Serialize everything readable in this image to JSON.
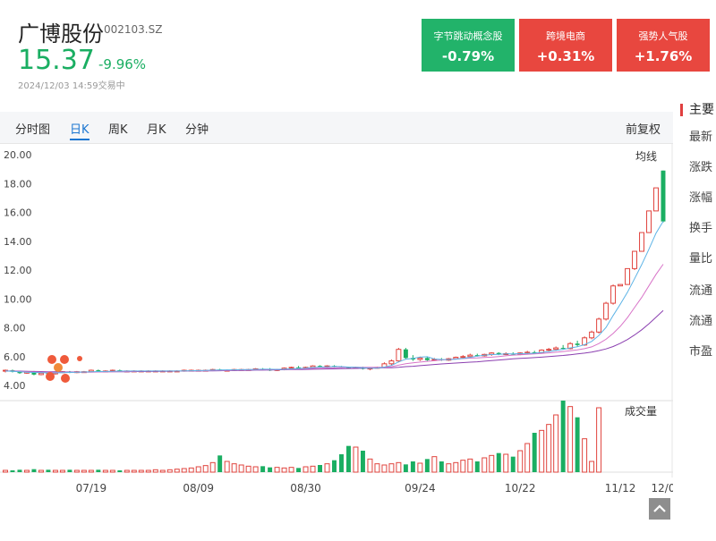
{
  "stock": {
    "name": "广博股份",
    "code": "002103.SZ",
    "price": "15.37",
    "change": "-9.96%",
    "time": "2024/12/03 14:59交易中"
  },
  "concepts": [
    {
      "name": "字节跳动概念股",
      "value": "-0.79%",
      "color": "#22b36a"
    },
    {
      "name": "跨境电商",
      "value": "+0.31%",
      "color": "#e8473f"
    },
    {
      "name": "强势人气股",
      "value": "+1.76%",
      "color": "#e8473f"
    }
  ],
  "tabs": [
    {
      "label": "分时图"
    },
    {
      "label": "日K"
    },
    {
      "label": "周K"
    },
    {
      "label": "月K"
    },
    {
      "label": "分钟"
    }
  ],
  "active_tab": "日K",
  "adjust_label": "前复权",
  "sidebar": {
    "title": "主要",
    "items": [
      "最新",
      "涨跌",
      "涨幅",
      "换手",
      "量比",
      "流通",
      "流通",
      "市盈"
    ]
  },
  "colors": {
    "up": "#e0433d",
    "down": "#1aae62",
    "ma5": "#5cb3e6",
    "ma10": "#d874c8",
    "ma20": "#8b3fb0"
  },
  "icons": {
    "logo": "weibo-logo-icon",
    "scroll": "chevron-up-icon"
  },
  "chart_data": {
    "type": "candlestick",
    "ma_label": "均线",
    "volume_label": "成交量",
    "y_ticks": [
      "20.00",
      "18.00",
      "16.00",
      "14.00",
      "12.00",
      "10.00",
      "8.00",
      "6.00",
      "4.00"
    ],
    "ylim": [
      4,
      20
    ],
    "x_ticks": [
      "07/19",
      "08/09",
      "08/30",
      "09/24",
      "10/22",
      "11/12",
      "12/0"
    ],
    "candles": [
      [
        5.0,
        5.1,
        4.9,
        5.05
      ],
      [
        5.05,
        5.1,
        4.9,
        4.95
      ],
      [
        4.95,
        5.0,
        4.8,
        4.85
      ],
      [
        4.85,
        5.0,
        4.8,
        4.95
      ],
      [
        4.95,
        5.0,
        4.7,
        4.75
      ],
      [
        4.75,
        4.9,
        4.7,
        4.85
      ],
      [
        4.85,
        4.9,
        4.75,
        4.8
      ],
      [
        4.8,
        4.95,
        4.75,
        4.9
      ],
      [
        4.9,
        5.0,
        4.85,
        4.95
      ],
      [
        4.95,
        5.0,
        4.85,
        4.9
      ],
      [
        4.9,
        5.0,
        4.85,
        4.95
      ],
      [
        4.95,
        5.0,
        4.9,
        4.95
      ],
      [
        4.95,
        5.1,
        4.9,
        5.05
      ],
      [
        5.05,
        5.1,
        4.95,
        5.0
      ],
      [
        5.0,
        5.05,
        4.95,
        5.0
      ],
      [
        5.0,
        5.1,
        4.95,
        5.05
      ],
      [
        5.05,
        5.1,
        5.0,
        5.0
      ],
      [
        5.0,
        5.05,
        4.95,
        5.0
      ],
      [
        5.0,
        5.05,
        4.95,
        5.0
      ],
      [
        5.0,
        5.05,
        4.95,
        5.0
      ],
      [
        5.0,
        5.05,
        4.95,
        5.0
      ],
      [
        5.0,
        5.05,
        4.95,
        5.0
      ],
      [
        5.0,
        5.05,
        4.95,
        5.0
      ],
      [
        5.0,
        5.05,
        4.95,
        5.0
      ],
      [
        5.0,
        5.05,
        4.95,
        5.0
      ],
      [
        5.0,
        5.1,
        4.95,
        5.05
      ],
      [
        5.05,
        5.1,
        5.0,
        5.05
      ],
      [
        5.05,
        5.1,
        5.0,
        5.05
      ],
      [
        5.05,
        5.1,
        5.0,
        5.05
      ],
      [
        5.05,
        5.15,
        5.0,
        5.1
      ],
      [
        5.1,
        5.15,
        5.0,
        5.05
      ],
      [
        5.05,
        5.1,
        5.0,
        5.05
      ],
      [
        5.05,
        5.15,
        5.0,
        5.1
      ],
      [
        5.1,
        5.15,
        5.05,
        5.1
      ],
      [
        5.1,
        5.15,
        5.05,
        5.1
      ],
      [
        5.1,
        5.2,
        5.05,
        5.15
      ],
      [
        5.15,
        5.2,
        5.05,
        5.1
      ],
      [
        5.1,
        5.2,
        5.0,
        5.05
      ],
      [
        5.05,
        5.15,
        5.0,
        5.1
      ],
      [
        5.1,
        5.25,
        5.05,
        5.2
      ],
      [
        5.2,
        5.3,
        5.1,
        5.25
      ],
      [
        5.25,
        5.35,
        5.15,
        5.2
      ],
      [
        5.2,
        5.3,
        5.15,
        5.25
      ],
      [
        5.25,
        5.4,
        5.2,
        5.35
      ],
      [
        5.35,
        5.4,
        5.25,
        5.3
      ],
      [
        5.3,
        5.4,
        5.25,
        5.35
      ],
      [
        5.35,
        5.4,
        5.25,
        5.3
      ],
      [
        5.3,
        5.35,
        5.2,
        5.25
      ],
      [
        5.25,
        5.3,
        5.15,
        5.2
      ],
      [
        5.2,
        5.3,
        5.15,
        5.25
      ],
      [
        5.25,
        5.3,
        5.1,
        5.15
      ],
      [
        5.15,
        5.25,
        5.05,
        5.2
      ],
      [
        5.2,
        5.3,
        5.15,
        5.25
      ],
      [
        5.25,
        5.6,
        5.2,
        5.5
      ],
      [
        5.5,
        5.8,
        5.4,
        5.7
      ],
      [
        5.7,
        6.6,
        5.6,
        6.5
      ],
      [
        6.5,
        6.6,
        5.8,
        5.9
      ],
      [
        5.9,
        6.1,
        5.7,
        5.8
      ],
      [
        5.8,
        6.0,
        5.7,
        5.9
      ],
      [
        5.9,
        6.0,
        5.7,
        5.75
      ],
      [
        5.75,
        5.9,
        5.7,
        5.8
      ],
      [
        5.8,
        5.9,
        5.7,
        5.75
      ],
      [
        5.75,
        5.9,
        5.7,
        5.85
      ],
      [
        5.85,
        6.0,
        5.8,
        5.95
      ],
      [
        5.95,
        6.1,
        5.85,
        6.0
      ],
      [
        6.0,
        6.2,
        5.9,
        6.1
      ],
      [
        6.1,
        6.2,
        6.0,
        6.05
      ],
      [
        6.05,
        6.2,
        6.0,
        6.15
      ],
      [
        6.15,
        6.3,
        6.05,
        6.25
      ],
      [
        6.25,
        6.3,
        6.1,
        6.15
      ],
      [
        6.15,
        6.3,
        6.1,
        6.2
      ],
      [
        6.2,
        6.3,
        6.1,
        6.15
      ],
      [
        6.15,
        6.3,
        6.1,
        6.25
      ],
      [
        6.25,
        6.4,
        6.15,
        6.3
      ],
      [
        6.3,
        6.4,
        6.2,
        6.25
      ],
      [
        6.25,
        6.5,
        6.2,
        6.45
      ],
      [
        6.45,
        6.6,
        6.35,
        6.5
      ],
      [
        6.5,
        6.7,
        6.4,
        6.6
      ],
      [
        6.6,
        6.8,
        6.5,
        6.55
      ],
      [
        6.55,
        7.0,
        6.5,
        6.9
      ],
      [
        6.9,
        7.1,
        6.7,
        6.8
      ],
      [
        6.8,
        7.4,
        6.75,
        7.3
      ],
      [
        7.3,
        7.8,
        7.2,
        7.7
      ],
      [
        7.7,
        8.7,
        7.6,
        8.6
      ],
      [
        8.6,
        9.8,
        8.5,
        9.7
      ],
      [
        9.7,
        11.0,
        9.6,
        10.9
      ],
      [
        10.9,
        11.0,
        10.9,
        11.0
      ],
      [
        11.0,
        12.1,
        11.0,
        12.1
      ],
      [
        12.1,
        13.3,
        12.0,
        13.3
      ],
      [
        13.3,
        14.6,
        13.3,
        14.6
      ],
      [
        14.6,
        16.1,
        14.6,
        16.1
      ],
      [
        16.1,
        17.7,
        16.1,
        17.7
      ],
      [
        18.9,
        18.9,
        15.3,
        15.37
      ]
    ],
    "volumes": [
      3,
      3,
      4,
      3,
      5,
      3,
      4,
      3,
      3,
      4,
      3,
      3,
      3,
      4,
      3,
      3,
      3,
      3,
      3,
      3,
      3,
      4,
      3,
      4,
      5,
      6,
      7,
      9,
      11,
      16,
      28,
      18,
      14,
      12,
      10,
      9,
      10,
      8,
      8,
      7,
      8,
      7,
      9,
      10,
      12,
      14,
      20,
      30,
      44,
      42,
      36,
      22,
      14,
      12,
      14,
      16,
      13,
      18,
      15,
      22,
      26,
      18,
      14,
      16,
      20,
      22,
      18,
      24,
      28,
      32,
      30,
      26,
      36,
      48,
      66,
      70,
      80,
      96,
      120,
      110,
      92,
      56,
      18,
      108
    ],
    "ma5": [
      5.0,
      4.98,
      4.95,
      4.92,
      4.9,
      4.88,
      4.87,
      4.87,
      4.88,
      4.9,
      4.92,
      4.93,
      4.95,
      4.96,
      4.97,
      4.98,
      4.99,
      5.0,
      5.0,
      5.0,
      5.0,
      5.0,
      5.0,
      5.0,
      5.0,
      5.01,
      5.02,
      5.03,
      5.04,
      5.06,
      5.07,
      5.08,
      5.08,
      5.09,
      5.1,
      5.11,
      5.12,
      5.12,
      5.11,
      5.12,
      5.15,
      5.18,
      5.2,
      5.24,
      5.27,
      5.29,
      5.31,
      5.3,
      5.27,
      5.25,
      5.23,
      5.2,
      5.2,
      5.27,
      5.38,
      5.63,
      5.82,
      5.88,
      5.96,
      5.99,
      5.83,
      5.8,
      5.79,
      5.81,
      5.87,
      5.95,
      6.03,
      6.09,
      6.14,
      6.16,
      6.18,
      6.19,
      6.2,
      6.22,
      6.23,
      6.29,
      6.35,
      6.43,
      6.5,
      6.6,
      6.68,
      6.83,
      7.05,
      7.46,
      8.02,
      8.85,
      9.64,
      10.46,
      11.4,
      12.38,
      13.44,
      14.56,
      15.38
    ],
    "ma10": [
      5.0,
      4.99,
      4.97,
      4.95,
      4.93,
      4.92,
      4.91,
      4.9,
      4.9,
      4.9,
      4.91,
      4.91,
      4.92,
      4.93,
      4.94,
      4.95,
      4.96,
      4.97,
      4.98,
      4.99,
      4.99,
      5.0,
      5.0,
      5.0,
      5.0,
      5.0,
      5.01,
      5.02,
      5.02,
      5.03,
      5.04,
      5.05,
      5.06,
      5.07,
      5.08,
      5.09,
      5.1,
      5.1,
      5.11,
      5.12,
      5.13,
      5.14,
      5.16,
      5.18,
      5.2,
      5.21,
      5.22,
      5.24,
      5.25,
      5.26,
      5.26,
      5.26,
      5.25,
      5.26,
      5.3,
      5.4,
      5.5,
      5.56,
      5.62,
      5.67,
      5.71,
      5.76,
      5.8,
      5.83,
      5.86,
      5.89,
      5.91,
      5.94,
      5.96,
      6.0,
      6.05,
      6.1,
      6.13,
      6.16,
      6.19,
      6.22,
      6.26,
      6.3,
      6.35,
      6.4,
      6.46,
      6.55,
      6.67,
      6.9,
      7.2,
      7.6,
      8.1,
      8.7,
      9.4,
      10.1,
      10.9,
      11.7,
      12.4
    ],
    "ma20": [
      5.0,
      5.0,
      4.99,
      4.98,
      4.97,
      4.96,
      4.95,
      4.94,
      4.93,
      4.93,
      4.93,
      4.93,
      4.93,
      4.93,
      4.94,
      4.94,
      4.95,
      4.95,
      4.96,
      4.96,
      4.97,
      4.97,
      4.98,
      4.98,
      4.99,
      4.99,
      5.0,
      5.0,
      5.01,
      5.01,
      5.02,
      5.03,
      5.03,
      5.04,
      5.05,
      5.06,
      5.06,
      5.07,
      5.08,
      5.09,
      5.1,
      5.1,
      5.11,
      5.12,
      5.13,
      5.14,
      5.15,
      5.16,
      5.17,
      5.18,
      5.19,
      5.2,
      5.21,
      5.22,
      5.23,
      5.26,
      5.3,
      5.33,
      5.37,
      5.41,
      5.45,
      5.49,
      5.52,
      5.55,
      5.58,
      5.61,
      5.64,
      5.68,
      5.72,
      5.76,
      5.8,
      5.84,
      5.87,
      5.9,
      5.93,
      5.96,
      6.0,
      6.04,
      6.08,
      6.13,
      6.18,
      6.24,
      6.31,
      6.41,
      6.53,
      6.7,
      6.92,
      7.18,
      7.5,
      7.86,
      8.27,
      8.73,
      9.2
    ]
  }
}
